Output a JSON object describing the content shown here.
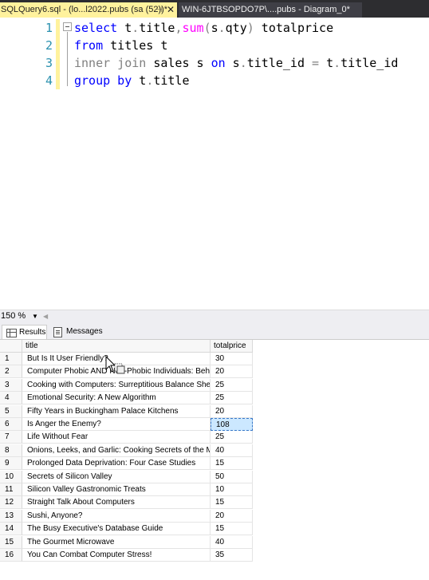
{
  "tabs": [
    {
      "label": "SQLQuery6.sql - (lo...l2022.pubs (sa (52))*",
      "pin": "⊣",
      "close": "✕"
    },
    {
      "label": "WIN-6JTBSOPDO7P\\....pubs - Diagram_0*"
    }
  ],
  "editor": {
    "line_numbers": [
      "1",
      "2",
      "3",
      "4"
    ]
  },
  "zoom": {
    "value": "150 %"
  },
  "result_tabs": [
    {
      "label": "Results",
      "icon": "grid-icon"
    },
    {
      "label": "Messages",
      "icon": "messages-icon"
    }
  ],
  "results": {
    "columns": [
      "title",
      "totalprice"
    ],
    "rows": [
      {
        "n": "1",
        "title": "But Is It User Friendly?",
        "totalprice": "30"
      },
      {
        "n": "2",
        "title": "Computer Phobic AND Non-Phobic Individuals: Behavior...",
        "totalprice": "20"
      },
      {
        "n": "3",
        "title": "Cooking with Computers: Surreptitious Balance Sheets",
        "totalprice": "25"
      },
      {
        "n": "4",
        "title": "Emotional Security: A New Algorithm",
        "totalprice": "25"
      },
      {
        "n": "5",
        "title": "Fifty Years in Buckingham Palace Kitchens",
        "totalprice": "20"
      },
      {
        "n": "6",
        "title": "Is Anger the Enemy?",
        "totalprice": "108"
      },
      {
        "n": "7",
        "title": "Life Without Fear",
        "totalprice": "25"
      },
      {
        "n": "8",
        "title": "Onions, Leeks, and Garlic: Cooking Secrets of the M...",
        "totalprice": "40"
      },
      {
        "n": "9",
        "title": "Prolonged Data Deprivation: Four Case Studies",
        "totalprice": "15"
      },
      {
        "n": "10",
        "title": "Secrets of Silicon Valley",
        "totalprice": "50"
      },
      {
        "n": "11",
        "title": "Silicon Valley Gastronomic Treats",
        "totalprice": "10"
      },
      {
        "n": "12",
        "title": "Straight Talk About Computers",
        "totalprice": "15"
      },
      {
        "n": "13",
        "title": "Sushi, Anyone?",
        "totalprice": "20"
      },
      {
        "n": "14",
        "title": "The Busy Executive's Database Guide",
        "totalprice": "15"
      },
      {
        "n": "15",
        "title": "The Gourmet Microwave",
        "totalprice": "40"
      },
      {
        "n": "16",
        "title": "You Can Combat Computer Stress!",
        "totalprice": "35"
      }
    ],
    "selected_row": 6
  }
}
